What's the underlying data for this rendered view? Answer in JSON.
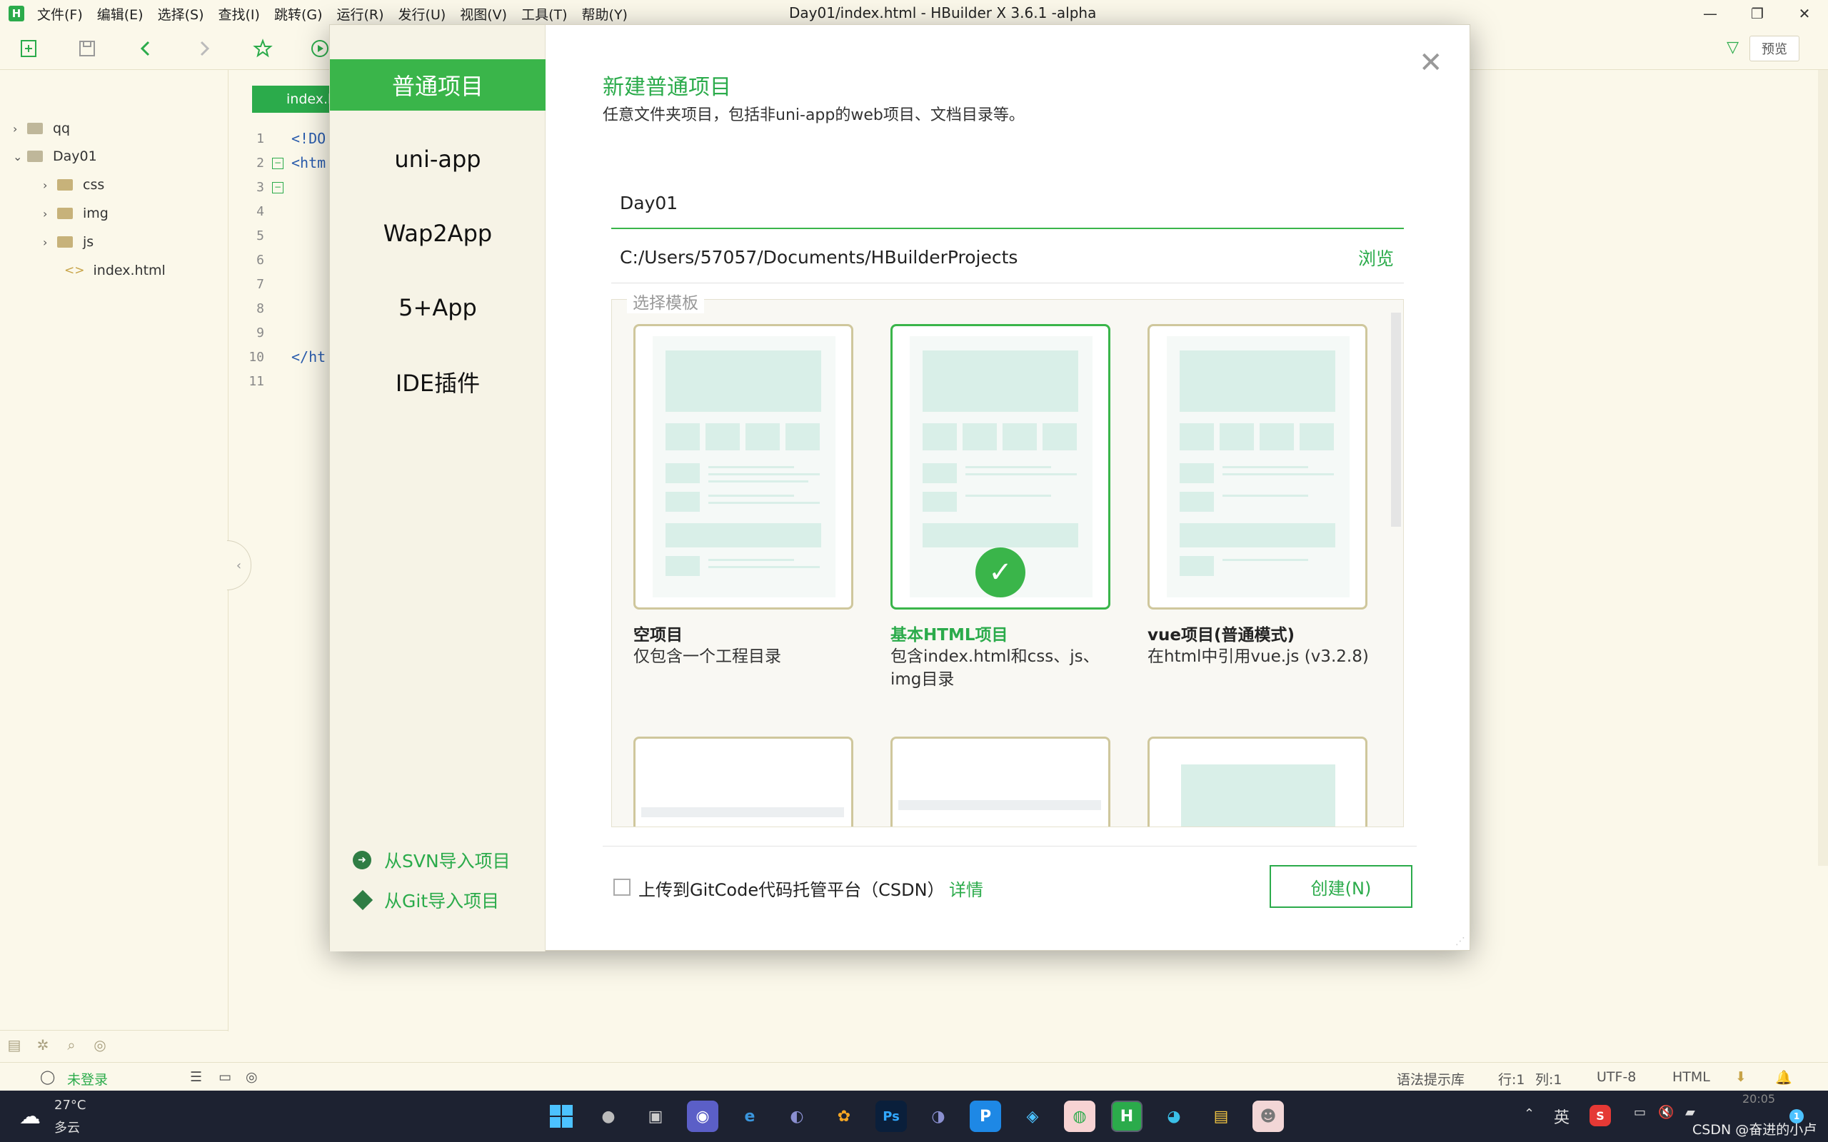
{
  "window": {
    "title": "Day01/index.html - HBuilder X 3.6.1 -alpha",
    "logo": "H",
    "controls": [
      "—",
      "❐",
      "✕"
    ]
  },
  "menu": [
    "文件(F)",
    "编辑(E)",
    "选择(S)",
    "查找(I)",
    "跳转(G)",
    "运行(R)",
    "发行(U)",
    "视图(V)",
    "工具(T)",
    "帮助(Y)"
  ],
  "toolbar": {
    "preview_label": "预览"
  },
  "tree": {
    "items": [
      {
        "label": "qq",
        "arrow": "›"
      },
      {
        "label": "Day01",
        "arrow": "⌄"
      },
      {
        "label": "css",
        "arrow": "›"
      },
      {
        "label": "img",
        "arrow": "›"
      },
      {
        "label": "js",
        "arrow": "›"
      },
      {
        "label": "index.html",
        "icon": "<>"
      }
    ]
  },
  "editor": {
    "tab_label": "index.h",
    "line_numbers": [
      "1",
      "2",
      "3",
      "4",
      "5",
      "6",
      "7",
      "8",
      "9",
      "10",
      "11"
    ],
    "code_lines": [
      "<!DO",
      "<htm",
      "</ht"
    ]
  },
  "statusbar": {
    "login": "未登录",
    "syntax": "语法提示库",
    "row": "行:1",
    "col": "列:1",
    "encoding": "UTF-8",
    "language": "HTML"
  },
  "modal": {
    "nav": [
      "普通项目",
      "uni-app",
      "Wap2App",
      "5+App",
      "IDE插件"
    ],
    "active_nav": "普通项目",
    "import_svn": "从SVN导入项目",
    "import_git": "从Git导入项目",
    "heading": "新建普通项目",
    "subtitle": "任意文件夹项目，包括非uni-app的web项目、文档目录等。",
    "project_name": "Day01",
    "project_path": "C:/Users/57057/Documents/HBuilderProjects",
    "browse_label": "浏览",
    "templates_legend": "选择模板",
    "templates": [
      {
        "title": "空项目",
        "desc": "仅包含一个工程目录",
        "selected": false
      },
      {
        "title": "基本HTML项目",
        "desc": "包含index.html和css、js、img目录",
        "selected": true
      },
      {
        "title": "vue项目(普通模式)",
        "desc": "在html中引用vue.js (v3.2.8)",
        "selected": false
      }
    ],
    "upload_label": "上传到GitCode代码托管平台（CSDN）",
    "detail_label": "详情",
    "create_label": "创建(N)",
    "close_glyph": "✕"
  },
  "taskbar": {
    "weather_temp": "27°C",
    "weather_desc": "多云",
    "ime": "英",
    "watermark": "CSDN @奋进的小卢",
    "time": "20:05",
    "notification_count": "1"
  },
  "colors": {
    "accent": "#3ab54a",
    "background": "#fbf8ea",
    "taskbar": "#1d2231"
  }
}
